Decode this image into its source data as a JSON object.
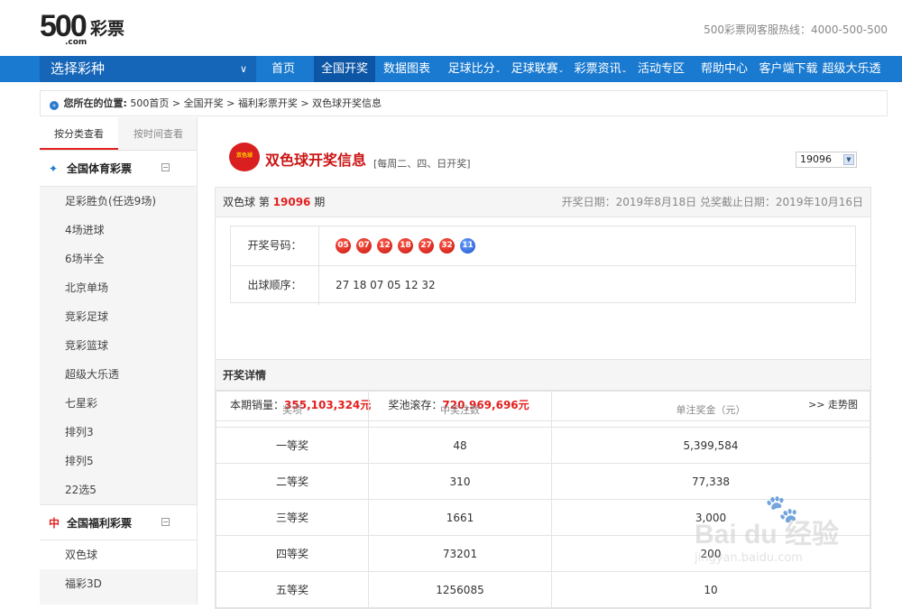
{
  "header": {
    "logo_num": "500",
    "logo_cn": "彩票",
    "logo_domain": ".com",
    "hotline": "500彩票网客服热线：4000-500-500"
  },
  "nav": {
    "select_label": "选择彩种",
    "items": [
      "首页",
      "全国开奖",
      "数据图表",
      "足球比分",
      "足球联赛",
      "彩票资讯",
      "活动专区",
      "帮助中心",
      "客户端下载",
      "超级大乐透"
    ],
    "active_index": 1
  },
  "breadcrumb": {
    "prefix": "您所在的位置:",
    "path": "500首页 > 全国开奖 > 福利彩票开奖 > 双色球开奖信息"
  },
  "sidebar": {
    "tabs": [
      "按分类查看",
      "按时间查看"
    ],
    "groups": [
      {
        "label": "全国体育彩票",
        "items": [
          "足彩胜负(任选9场)",
          "4场进球",
          "6场半全",
          "北京单场",
          "竞彩足球",
          "竞彩篮球",
          "超级大乐透",
          "七星彩",
          "排列3",
          "排列5",
          "22选5"
        ]
      },
      {
        "label": "全国福利彩票",
        "items": [
          "双色球",
          "福彩3D"
        ]
      }
    ]
  },
  "main": {
    "badge_text": "双色球",
    "title": "双色球开奖信息",
    "subtitle": "[每周二、四、日开奖]",
    "issue_select": "19096",
    "issue_prefix": "双色球 第",
    "issue_number": "19096",
    "issue_suffix": "期",
    "dates": "开奖日期：2019年8月18日 兑奖截止日期：2019年10月16日",
    "code_label": "开奖号码：",
    "red_balls": [
      "05",
      "07",
      "12",
      "18",
      "27",
      "32"
    ],
    "blue_ball": "11",
    "order_label": "出球顺序：",
    "order": "27 18 07 05 12 32",
    "sales_label": "本期销量：",
    "sales_value": "355,103,324元",
    "pool_label": "奖池滚存：",
    "pool_value": "720,969,696元",
    "trend_link": ">> 走势图"
  },
  "detail": {
    "title": "开奖详情",
    "headers": [
      "奖项",
      "中奖注数",
      "单注奖金（元）"
    ],
    "rows": [
      [
        "一等奖",
        "48",
        "5,399,584"
      ],
      [
        "二等奖",
        "310",
        "77,338"
      ],
      [
        "三等奖",
        "1661",
        "3,000"
      ],
      [
        "四等奖",
        "73201",
        "200"
      ],
      [
        "五等奖",
        "1256085",
        "10"
      ]
    ]
  },
  "watermark": {
    "brand": "Bai du 经验",
    "url": "jingyan.baidu.com"
  }
}
